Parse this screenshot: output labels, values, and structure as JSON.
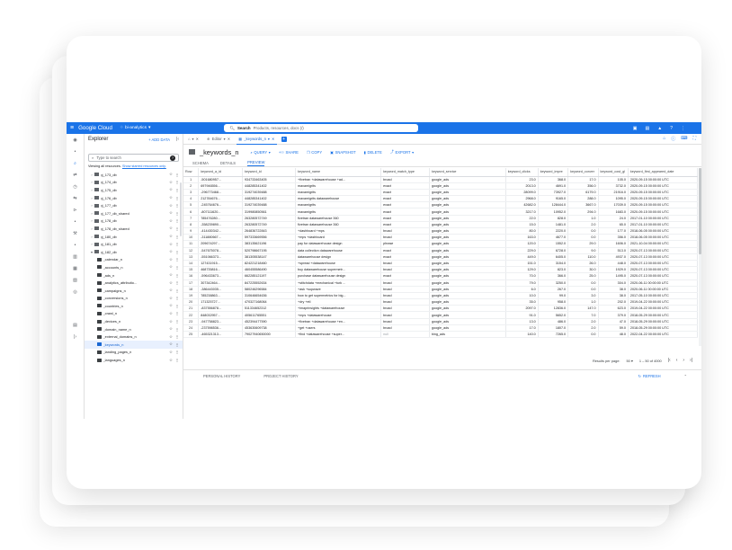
{
  "topbar": {
    "menu_icon": "hamburger-icon",
    "brand": "Google Cloud",
    "project": "bi-analytics",
    "search_label": "Search",
    "search_placeholder": "Products, resources, docs (/)"
  },
  "explorer": {
    "title": "Explorer",
    "add_data": "+ ADD DATA",
    "search_placeholder": "Type to search",
    "note": "Viewing all resources.",
    "note_link": "Show starred resources only.",
    "items": [
      {
        "name": "pj_173_db",
        "type": "dataset",
        "expanded": false
      },
      {
        "name": "pj_174_db",
        "type": "dataset",
        "expanded": false
      },
      {
        "name": "pj_175_db",
        "type": "dataset",
        "expanded": false
      },
      {
        "name": "pj_176_db",
        "type": "dataset",
        "expanded": false
      },
      {
        "name": "pj_177_db",
        "type": "dataset",
        "expanded": false
      },
      {
        "name": "pj_177_db_shared",
        "type": "dataset",
        "expanded": false
      },
      {
        "name": "pj_178_db",
        "type": "dataset",
        "expanded": false
      },
      {
        "name": "pj_178_db_shared",
        "type": "dataset",
        "expanded": false
      },
      {
        "name": "pj_180_db",
        "type": "dataset",
        "expanded": false
      },
      {
        "name": "pj_181_db",
        "type": "dataset",
        "expanded": false
      },
      {
        "name": "pj_182_db",
        "type": "dataset",
        "expanded": true
      },
      {
        "name": "_calendar_n",
        "type": "table"
      },
      {
        "name": "_accounts_n",
        "type": "table"
      },
      {
        "name": "_ads_n",
        "type": "table"
      },
      {
        "name": "_analytics_attributio...",
        "type": "table"
      },
      {
        "name": "_campaigns_n",
        "type": "table"
      },
      {
        "name": "_conversions_n",
        "type": "table"
      },
      {
        "name": "_countries_n",
        "type": "table"
      },
      {
        "name": "_crawl_n",
        "type": "table"
      },
      {
        "name": "_devices_n",
        "type": "table"
      },
      {
        "name": "_domain_name_n",
        "type": "table"
      },
      {
        "name": "_external_domains_n",
        "type": "table"
      },
      {
        "name": "_keywords_n",
        "type": "table",
        "selected": true
      },
      {
        "name": "_landing_pages_n",
        "type": "table"
      },
      {
        "name": "_languages_n",
        "type": "table"
      }
    ]
  },
  "tabs": [
    {
      "label": "Editor",
      "active": false
    },
    {
      "label": "_keywords_n",
      "active": true
    }
  ],
  "table_header": {
    "name": "_keywords_n",
    "actions": [
      "QUERY",
      "SHARE",
      "COPY",
      "SNAPSHOT",
      "DELETE",
      "EXPORT"
    ]
  },
  "subtabs": [
    "SCHEMA",
    "DETAILS",
    "PREVIEW"
  ],
  "grid": {
    "columns": [
      "Row",
      "keyword_a_id",
      "keyword_id",
      "keyword_name",
      "keyword_match_type",
      "keyword_service",
      "keyword_clicks",
      "keyword_impre",
      "keyword_conver",
      "keyword_cost_gl",
      "keyword_first_appeared_date"
    ],
    "rows": [
      [
        "1",
        "-501680957...",
        "934733463405",
        "+fivetran +datawarehouse +ad...",
        "broad",
        "google_ads",
        "23.0",
        "368.0",
        "17.0",
        "105.0",
        "2020-09-15 00:00:00 UTC"
      ],
      [
        "2",
        "697946556...",
        "448285341402",
        "maxamigrits",
        "exact",
        "google_ads",
        "2013.0",
        "4691.0",
        "356.0",
        "3732.0",
        "2020-09-15 00:00:00 UTC"
      ],
      [
        "3",
        "-296773468...",
        "319274039488",
        "maxamigrits",
        "exact",
        "google_ads",
        "28099.0",
        "73927.0",
        "6179.0",
        "21916.0",
        "2020-09-15 00:00:00 UTC"
      ],
      [
        "4",
        "212784676...",
        "448285341402",
        "maxamigrits datawarehouse",
        "exact",
        "google_ads",
        "2968.0",
        "9165.0",
        "288.0",
        "1095.0",
        "2020-09-15 00:00:00 UTC"
      ],
      [
        "5",
        "-245764676...",
        "319274039488",
        "maxamigrits",
        "exact",
        "google_ads",
        "42682.0",
        "128444.0",
        "3667.0",
        "17039.0",
        "2020-09-15 00:00:00 UTC"
      ],
      [
        "6",
        "-807111620...",
        "319980850561",
        "maxamigrits",
        "exact",
        "google_ads",
        "3217.0",
        "10952.0",
        "294.0",
        "1683.0",
        "2020-09-15 00:00:00 UTC"
      ],
      [
        "7",
        "785476280...",
        "263280572749",
        "fivetran datawarehouse 360",
        "exact",
        "google_ads",
        "22.0",
        "828.0",
        "1.0",
        "24.0",
        "2017-01-10 00:00:00 UTC"
      ],
      [
        "8",
        "-358239890...",
        "263280572749",
        "fivetran datawarehouse 360",
        "exact",
        "google_ads",
        "15.0",
        "1481.0",
        "2.0",
        "65.0",
        "2017-01-10 00:00:00 UTC"
      ],
      [
        "9",
        "-414430342...",
        "264836722843",
        "+dashboard +mps",
        "broad",
        "google_ads",
        "80.0",
        "2220.0",
        "0.0",
        "177.0",
        "2018-06-05 00:00:00 UTC"
      ],
      [
        "10",
        "-311880667...",
        "597333669556",
        "+mps +dashboard",
        "broad",
        "google_ads",
        "163.0",
        "4677.0",
        "0.0",
        "356.0",
        "2018-06-05 00:00:00 UTC"
      ],
      [
        "11",
        "209674297...",
        "383135621196",
        "pay for datawarehouse design",
        "phrase",
        "google_ads",
        "120.0",
        "1552.0",
        "29.0",
        "1606.0",
        "2021-10-04 00:00:00 UTC"
      ],
      [
        "12",
        "-547675078...",
        "520798667195",
        "data collection datawarehouse",
        "exact",
        "google_ads",
        "229.0",
        "6728.0",
        "9.0",
        "513.0",
        "2020-07-13 00:00:00 UTC"
      ],
      [
        "13",
        "-551066373...",
        "381305538147",
        "datawarehouse design",
        "exact",
        "google_ads",
        "449.0",
        "6405.0",
        "110.0",
        "4937.0",
        "2020-07-13 00:00:00 UTC"
      ],
      [
        "14",
        "127431915...",
        "824221218460",
        "+spread +datawarehouse",
        "broad",
        "google_ads",
        "151.0",
        "3154.0",
        "26.0",
        "448.0",
        "2020-07-13 00:00:00 UTC"
      ],
      [
        "15",
        "468735816...",
        "460455586490",
        "buy datawarehouse supermetr...",
        "broad",
        "google_ads",
        "129.0",
        "823.0",
        "30.0",
        "1929.0",
        "2020-07-13 00:00:00 UTC"
      ],
      [
        "16",
        "-596433673...",
        "662285121197",
        "purchase datawarehouse design",
        "exact",
        "google_ads",
        "70.0",
        "366.0",
        "25.0",
        "1495.0",
        "2020-07-13 00:00:00 UTC"
      ],
      [
        "17",
        "307342464...",
        "847225552634",
        "+stitchdata +mechanical +turk ...",
        "broad",
        "google_ads",
        "79.0",
        "3250.0",
        "0.0",
        "304.0",
        "2020-06-11 00:00:00 UTC"
      ],
      [
        "18",
        "-386443035...",
        "580246296584",
        "+ask +supwave",
        "broad",
        "google_ads",
        "6.0",
        "267.0",
        "0.0",
        "38.0",
        "2020-06-11 00:00:00 UTC"
      ],
      [
        "19",
        "785238863...",
        "310646654636",
        "how to get supermetrics for big...",
        "broad",
        "google_ads",
        "10.0",
        "99.0",
        "3.0",
        "38.0",
        "2017-05-10 00:00:00 UTC"
      ],
      [
        "20",
        "171325727...",
        "470327168064",
        "+dry +etl",
        "broad",
        "google_ads",
        "35.0",
        "958.0",
        "1.0",
        "202.0",
        "2019-04-22 00:00:00 UTC"
      ],
      [
        "21",
        "-837556878...",
        "511334652312",
        "+imaprinsights +datawarehouse",
        "broad",
        "google_ads",
        "2097.0",
        "12836.0",
        "147.0",
        "623.0",
        "2019-04-22 00:00:00 UTC"
      ],
      [
        "22",
        "848032957...",
        "405611765551",
        "+mps +datawarehouse",
        "broad",
        "google_ads",
        "91.0",
        "5652.0",
        "7.0",
        "379.0",
        "2018-05-29 00:00:00 UTC"
      ],
      [
        "23",
        "-947758823...",
        "452394477590",
        "+fivetran +datawarehouse +en...",
        "broad",
        "google_ads",
        "13.0",
        "486.0",
        "2.0",
        "47.0",
        "2018-05-29 00:00:00 UTC"
      ],
      [
        "24",
        "-237598536...",
        "453630609738",
        "+get +users",
        "broad",
        "google_ads",
        "17.0",
        "1807.0",
        "2.0",
        "59.0",
        "2018-05-29 00:00:00 UTC"
      ],
      [
        "25",
        "-465321313...",
        "79027940650000",
        "+find +datawarehouse +super...",
        "null",
        "bing_ads",
        "140.0",
        "7265.0",
        "0.0",
        "48.0",
        "2022-04-22 00:00:00 UTC"
      ]
    ]
  },
  "pager": {
    "results_label": "Results per page:",
    "per_page": "50",
    "range": "1 – 50 of 4000"
  },
  "bottom": {
    "personal_history": "PERSONAL HISTORY",
    "project_history": "PROJECT HISTORY",
    "refresh": "REFRESH"
  }
}
